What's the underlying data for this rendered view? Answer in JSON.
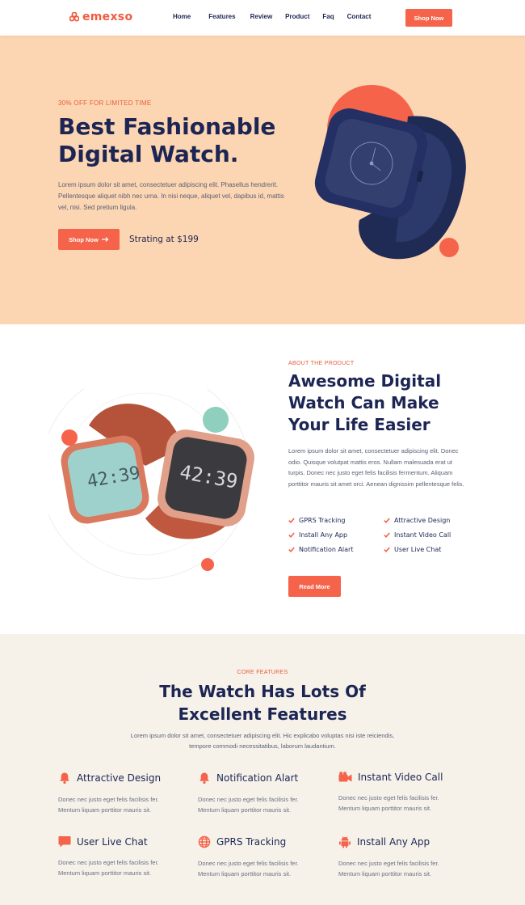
{
  "nav": {
    "logo": "emexso",
    "links": [
      "Home",
      "Features",
      "Review",
      "Product",
      "Faq",
      "Contact"
    ],
    "cta": "Shop Now"
  },
  "hero": {
    "eyebrow": "30% OFF FOR LIMITED TIME",
    "title": "Best Fashionable Digital Watch.",
    "description": "Lorem ipsum dolor sit amet, consectetuer adipiscing elit. Phasellus hendrerit. Pellentesque aliquet nibh nec urna. In nisi neque, aliquet vel, dapibus id, mattis vel, nisi. Sed pretium ligula.",
    "button": "Shop Now",
    "price": "Strating at $199"
  },
  "about": {
    "eyebrow": "ABOUT THE PRODUCT",
    "title": "Awesome Digital Watch Can Make Your Life Easier",
    "description": "Lorem ipsum dolor sit amet, consectetuer adipiscing elit. Donec odio. Quisque volutpat mattis eros. Nullam malesuada erat ut turpis. Donec nec justo eget felis facilisis fermentum. Aliquam porttitor mauris sit amet orci. Aenean dignissim pellentesque felis.",
    "features": [
      "GPRS Tracking",
      "Attractive Design",
      "Install Any App",
      "Instant Video Call",
      "Notification Alart",
      "User Live Chat"
    ],
    "button": "Read More",
    "watch_face_left": "42:39",
    "watch_face_right": "42:39"
  },
  "features": {
    "eyebrow": "CORE FEATURES",
    "title": "The Watch Has Lots Of Excellent Features",
    "description": "Lorem ipsum dolor sit amet, consectetuer adipiscing elit. Hic explicabo voluptas nisi iste reiciendis, tempore commodi necessitatibus, laborum laudantium.",
    "cards": [
      {
        "icon": "bell-icon",
        "title": "Attractive Design",
        "text": "Donec nec justo eget felis facilisis fer. Mentum liquam porttitor mauris sit."
      },
      {
        "icon": "bell-icon",
        "title": "Notification Alart",
        "text": "Donec nec justo eget felis facilisis fer. Mentum liquam porttitor mauris sit."
      },
      {
        "icon": "video-camera-icon",
        "title": "Instant Video Call",
        "text": "Donec nec justo eget felis facilisis fer. Mentum liquam porttitor mauris sit."
      },
      {
        "icon": "chat-bubble-icon",
        "title": "User Live Chat",
        "text": "Donec nec justo eget felis facilisis fer. Mentum liquam porttitor mauris sit."
      },
      {
        "icon": "globe-icon",
        "title": "GPRS Tracking",
        "text": "Donec nec justo eget felis facilisis fer. Mentum liquam porttitor mauris sit."
      },
      {
        "icon": "android-icon",
        "title": "Install Any App",
        "text": "Donec nec justo eget felis facilisis fer. Mentum liquam porttitor mauris sit."
      }
    ]
  },
  "colors": {
    "accent": "#f4634a",
    "navy": "#1c2553",
    "hero_bg": "#fcd6b2",
    "features_bg": "#f6f2ea"
  }
}
